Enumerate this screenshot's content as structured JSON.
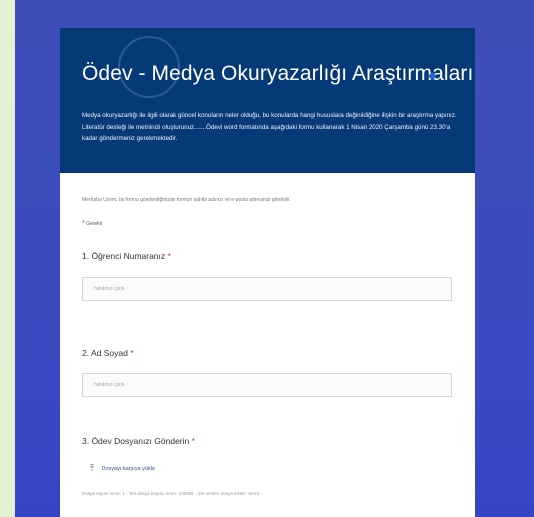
{
  "form": {
    "title": "Ödev - Medya Okuryazarlığı Araştırmaları",
    "description": "Medya okuryazarlığı ile ilgili olarak güncel konuların neler olduğu, bu konularda hangi hususlara değinildiğine ilişkin bir araştırma yapınız. Literatür desteği ile metninizi oluşturunuz.......Ödevi word formatında aşağıdaki formu kullanarak 1 Nisan 2020 Çarşamba günü 23.30'a kadar göndermeniz gerekmektedir.",
    "notice": "Merhaba Uzem, bu formu gönderdiğinizde formun sahibi adınızı ve e-posta adresinizi görebilir.",
    "required_mark": "*",
    "required_text": "Gerekli"
  },
  "questions": [
    {
      "label": "1. Öğrenci Numaranız",
      "star": "*",
      "placeholder": "Yanıtınızı girin"
    },
    {
      "label": "2. Ad Soyad",
      "star": "*",
      "placeholder": "Yanıtınızı girin"
    },
    {
      "label": "3. Ödev Dosyanızı Gönderin",
      "star": "*"
    }
  ],
  "upload": {
    "icon": "upload-icon",
    "label": "Dosyayı karşıya yükle",
    "hint": "Dosya sayısı sınırı: 1 · Tek dosya boyutu sınırı: 100MB · İzin verilen dosya türleri: Word"
  },
  "colors": {
    "header_bg": "#063977",
    "stage_bg": "#3b4cbf",
    "outer_bg": "#e2f0d4",
    "required_star": "#c0392b"
  }
}
